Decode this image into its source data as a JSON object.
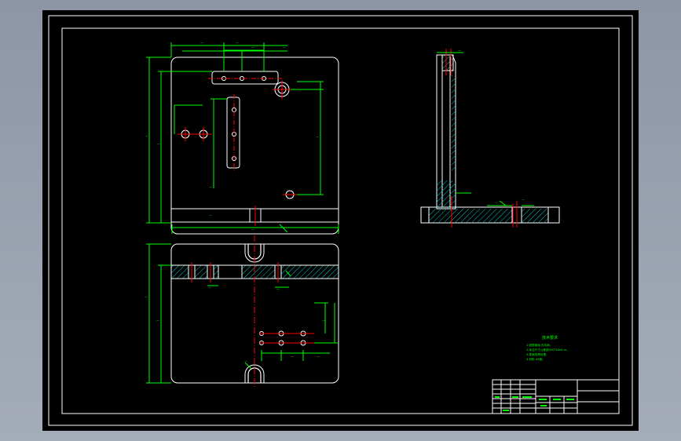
{
  "drawing": {
    "background_color": "#000000",
    "line_color": "#ffffff",
    "dimension_color": "#00ff00",
    "centerline_color": "#ff0000",
    "hatch_color": "#00ffff",
    "text_color": "#00ff00"
  },
  "technical_requirements": {
    "title": "技术要求",
    "lines": [
      "1.锐角倒钝,去毛刺。",
      "2.未注尺寸公差按GB/T1804-m。",
      "3.表面发黑处理。",
      "4.材料:45钢。"
    ]
  }
}
